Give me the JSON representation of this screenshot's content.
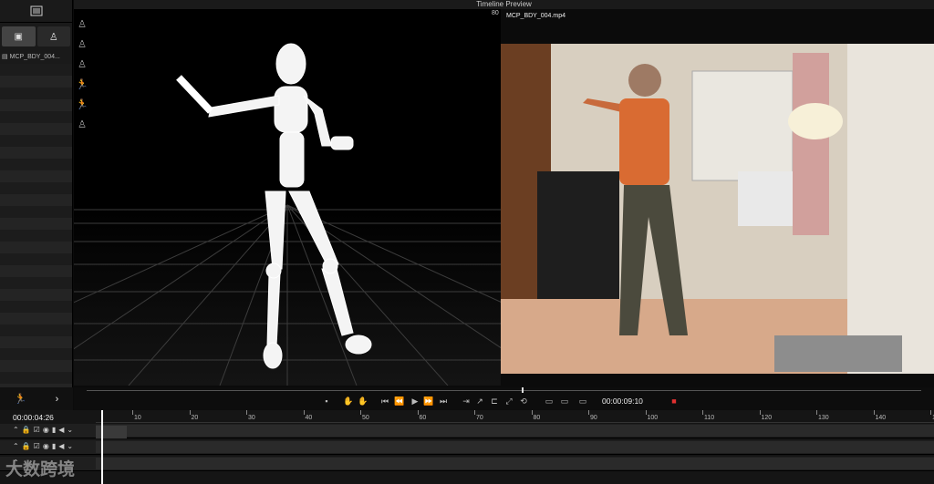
{
  "header": {
    "title": "Timeline Preview"
  },
  "preview": {
    "frame": "80",
    "video_title": "MCP_BDY_004.mp4"
  },
  "sidebar": {
    "file_label": "MCP_BDY_004..."
  },
  "transport": {
    "timecode": "00:00:09:10"
  },
  "timeline": {
    "timecode": "00:00:04:26",
    "ticks": [
      "10",
      "20",
      "30",
      "40",
      "50",
      "60",
      "70",
      "80",
      "90",
      "100",
      "110",
      "120",
      "130",
      "140",
      "150"
    ]
  },
  "watermark": {
    "text": "大数跨境"
  },
  "icons": [
    "list-icon",
    "clip-icon",
    "person-icon",
    "pose-icon",
    "play-icon",
    "rewind-icon",
    "record-icon"
  ]
}
